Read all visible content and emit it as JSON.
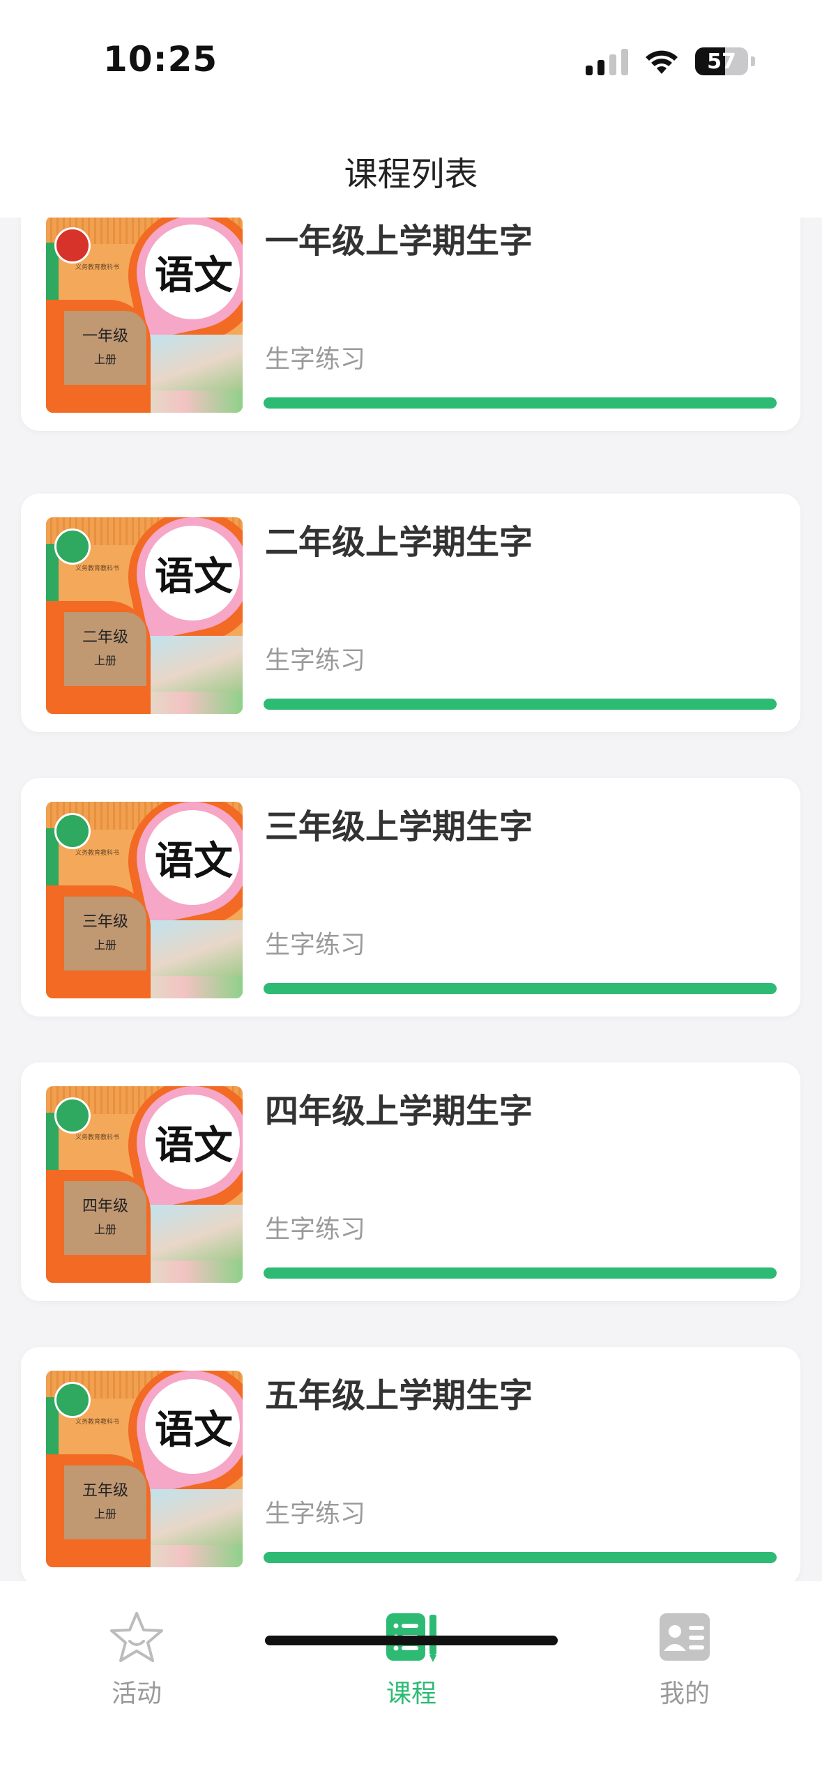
{
  "status_bar": {
    "time": "10:25",
    "battery": "57"
  },
  "header": {
    "title": "课程列表"
  },
  "courses": [
    {
      "title": "一年级上学期生字",
      "subtitle": "生字练习",
      "progress": 1.0,
      "cover": {
        "title": "语文",
        "grade": "一年级",
        "volume": "上册",
        "publisher": "义务教育教科书"
      }
    },
    {
      "title": "二年级上学期生字",
      "subtitle": "生字练习",
      "progress": 1.0,
      "cover": {
        "title": "语文",
        "grade": "二年级",
        "volume": "上册",
        "publisher": "义务教育教科书"
      }
    },
    {
      "title": "三年级上学期生字",
      "subtitle": "生字练习",
      "progress": 1.0,
      "cover": {
        "title": "语文",
        "grade": "三年级",
        "volume": "上册",
        "publisher": "义务教育教科书"
      }
    },
    {
      "title": "四年级上学期生字",
      "subtitle": "生字练习",
      "progress": 1.0,
      "cover": {
        "title": "语文",
        "grade": "四年级",
        "volume": "上册",
        "publisher": "义务教育教科书"
      }
    },
    {
      "title": "五年级上学期生字",
      "subtitle": "生字练习",
      "progress": 1.0,
      "cover": {
        "title": "语文",
        "grade": "五年级",
        "volume": "上册",
        "publisher": "义务教育教科书"
      }
    }
  ],
  "tabbar": {
    "items": [
      {
        "label": "活动",
        "icon": "star-icon",
        "active": false
      },
      {
        "label": "课程",
        "icon": "course-list-icon",
        "active": true
      },
      {
        "label": "我的",
        "icon": "profile-card-icon",
        "active": false
      }
    ]
  },
  "colors": {
    "accent": "#2dbb74",
    "inactive": "#9a9a9a",
    "background": "#f4f4f6"
  }
}
